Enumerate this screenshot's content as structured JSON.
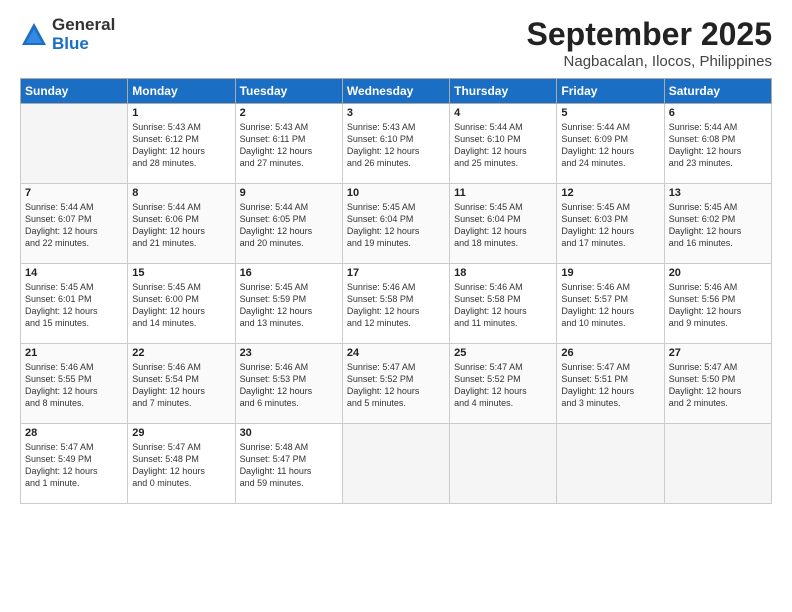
{
  "logo": {
    "general": "General",
    "blue": "Blue"
  },
  "title": "September 2025",
  "location": "Nagbacalan, Ilocos, Philippines",
  "headers": [
    "Sunday",
    "Monday",
    "Tuesday",
    "Wednesday",
    "Thursday",
    "Friday",
    "Saturday"
  ],
  "weeks": [
    [
      {
        "day": "",
        "content": ""
      },
      {
        "day": "1",
        "content": "Sunrise: 5:43 AM\nSunset: 6:12 PM\nDaylight: 12 hours\nand 28 minutes."
      },
      {
        "day": "2",
        "content": "Sunrise: 5:43 AM\nSunset: 6:11 PM\nDaylight: 12 hours\nand 27 minutes."
      },
      {
        "day": "3",
        "content": "Sunrise: 5:43 AM\nSunset: 6:10 PM\nDaylight: 12 hours\nand 26 minutes."
      },
      {
        "day": "4",
        "content": "Sunrise: 5:44 AM\nSunset: 6:10 PM\nDaylight: 12 hours\nand 25 minutes."
      },
      {
        "day": "5",
        "content": "Sunrise: 5:44 AM\nSunset: 6:09 PM\nDaylight: 12 hours\nand 24 minutes."
      },
      {
        "day": "6",
        "content": "Sunrise: 5:44 AM\nSunset: 6:08 PM\nDaylight: 12 hours\nand 23 minutes."
      }
    ],
    [
      {
        "day": "7",
        "content": "Sunrise: 5:44 AM\nSunset: 6:07 PM\nDaylight: 12 hours\nand 22 minutes."
      },
      {
        "day": "8",
        "content": "Sunrise: 5:44 AM\nSunset: 6:06 PM\nDaylight: 12 hours\nand 21 minutes."
      },
      {
        "day": "9",
        "content": "Sunrise: 5:44 AM\nSunset: 6:05 PM\nDaylight: 12 hours\nand 20 minutes."
      },
      {
        "day": "10",
        "content": "Sunrise: 5:45 AM\nSunset: 6:04 PM\nDaylight: 12 hours\nand 19 minutes."
      },
      {
        "day": "11",
        "content": "Sunrise: 5:45 AM\nSunset: 6:04 PM\nDaylight: 12 hours\nand 18 minutes."
      },
      {
        "day": "12",
        "content": "Sunrise: 5:45 AM\nSunset: 6:03 PM\nDaylight: 12 hours\nand 17 minutes."
      },
      {
        "day": "13",
        "content": "Sunrise: 5:45 AM\nSunset: 6:02 PM\nDaylight: 12 hours\nand 16 minutes."
      }
    ],
    [
      {
        "day": "14",
        "content": "Sunrise: 5:45 AM\nSunset: 6:01 PM\nDaylight: 12 hours\nand 15 minutes."
      },
      {
        "day": "15",
        "content": "Sunrise: 5:45 AM\nSunset: 6:00 PM\nDaylight: 12 hours\nand 14 minutes."
      },
      {
        "day": "16",
        "content": "Sunrise: 5:45 AM\nSunset: 5:59 PM\nDaylight: 12 hours\nand 13 minutes."
      },
      {
        "day": "17",
        "content": "Sunrise: 5:46 AM\nSunset: 5:58 PM\nDaylight: 12 hours\nand 12 minutes."
      },
      {
        "day": "18",
        "content": "Sunrise: 5:46 AM\nSunset: 5:58 PM\nDaylight: 12 hours\nand 11 minutes."
      },
      {
        "day": "19",
        "content": "Sunrise: 5:46 AM\nSunset: 5:57 PM\nDaylight: 12 hours\nand 10 minutes."
      },
      {
        "day": "20",
        "content": "Sunrise: 5:46 AM\nSunset: 5:56 PM\nDaylight: 12 hours\nand 9 minutes."
      }
    ],
    [
      {
        "day": "21",
        "content": "Sunrise: 5:46 AM\nSunset: 5:55 PM\nDaylight: 12 hours\nand 8 minutes."
      },
      {
        "day": "22",
        "content": "Sunrise: 5:46 AM\nSunset: 5:54 PM\nDaylight: 12 hours\nand 7 minutes."
      },
      {
        "day": "23",
        "content": "Sunrise: 5:46 AM\nSunset: 5:53 PM\nDaylight: 12 hours\nand 6 minutes."
      },
      {
        "day": "24",
        "content": "Sunrise: 5:47 AM\nSunset: 5:52 PM\nDaylight: 12 hours\nand 5 minutes."
      },
      {
        "day": "25",
        "content": "Sunrise: 5:47 AM\nSunset: 5:52 PM\nDaylight: 12 hours\nand 4 minutes."
      },
      {
        "day": "26",
        "content": "Sunrise: 5:47 AM\nSunset: 5:51 PM\nDaylight: 12 hours\nand 3 minutes."
      },
      {
        "day": "27",
        "content": "Sunrise: 5:47 AM\nSunset: 5:50 PM\nDaylight: 12 hours\nand 2 minutes."
      }
    ],
    [
      {
        "day": "28",
        "content": "Sunrise: 5:47 AM\nSunset: 5:49 PM\nDaylight: 12 hours\nand 1 minute."
      },
      {
        "day": "29",
        "content": "Sunrise: 5:47 AM\nSunset: 5:48 PM\nDaylight: 12 hours\nand 0 minutes."
      },
      {
        "day": "30",
        "content": "Sunrise: 5:48 AM\nSunset: 5:47 PM\nDaylight: 11 hours\nand 59 minutes."
      },
      {
        "day": "",
        "content": ""
      },
      {
        "day": "",
        "content": ""
      },
      {
        "day": "",
        "content": ""
      },
      {
        "day": "",
        "content": ""
      }
    ]
  ]
}
